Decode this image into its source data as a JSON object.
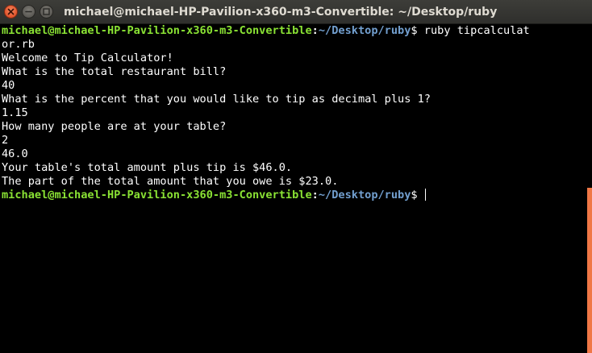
{
  "window": {
    "title": "michael@michael-HP-Pavilion-x360-m3-Convertible: ~/Desktop/ruby"
  },
  "colors": {
    "prompt_user": "#8ae234",
    "prompt_path": "#729fcf",
    "text": "#ffffff",
    "background": "#000000",
    "close_button": "#e2532b",
    "scroll_thumb": "#f07746"
  },
  "icons": {
    "close": "close-icon",
    "minimize": "minimize-icon",
    "maximize": "maximize-icon"
  },
  "terminal": {
    "prompt1": {
      "user": "michael@michael-HP-Pavilion-x360-m3-Convertible",
      "colon": ":",
      "path": "~/Desktop/ruby",
      "dollar": "$ ",
      "command": "ruby tipcalculat"
    },
    "wrap_line": "or.rb",
    "output": [
      "Welcome to Tip Calculator!",
      "What is the total restaurant bill?",
      "40",
      "What is the percent that you would like to tip as decimal plus 1?",
      "1.15",
      "How many people are at your table?",
      "2",
      "46.0",
      "Your table's total amount plus tip is $46.0.",
      "The part of the total amount that you owe is $23.0."
    ],
    "prompt2": {
      "user": "michael@michael-HP-Pavilion-x360-m3-Convertible",
      "colon": ":",
      "path": "~/Desktop/ruby",
      "dollar": "$ "
    }
  }
}
